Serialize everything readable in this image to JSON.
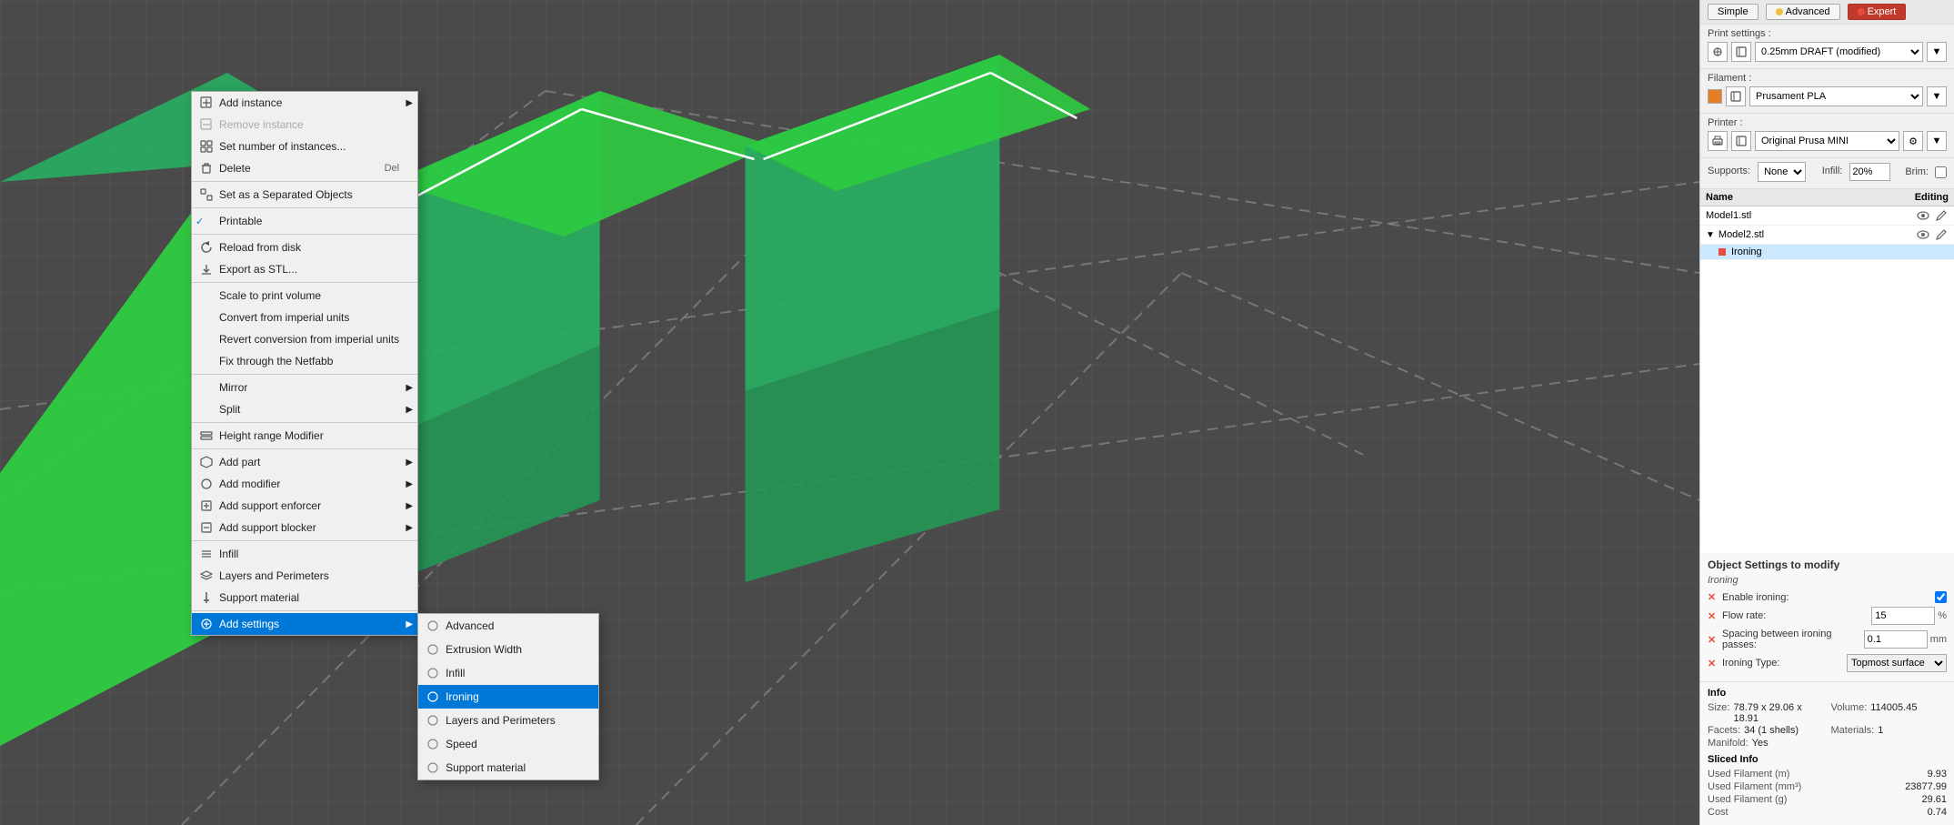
{
  "print_settings": {
    "label": "Print settings :",
    "profile": "0.25mm DRAFT (modified)",
    "filament_label": "Filament :",
    "filament": "Prusament PLA",
    "printer_label": "Printer :",
    "printer": "Original Prusa MINI",
    "supports_label": "Supports:",
    "supports_value": "None",
    "infill_label": "Infill:",
    "infill_value": "20%",
    "brim_label": "Brim:",
    "brim_checked": false
  },
  "modes": {
    "simple": "Simple",
    "advanced": "Advanced",
    "expert": "Expert"
  },
  "object_list": {
    "header_name": "Name",
    "header_editing": "Editing",
    "objects": [
      {
        "id": "model1",
        "name": "Model1.stl",
        "selected": false
      },
      {
        "id": "model2",
        "name": "Model2.stl",
        "selected": false,
        "has_child": true,
        "child": {
          "name": "Ironing",
          "selected": true
        }
      }
    ]
  },
  "context_menu": {
    "items": [
      {
        "id": "add-instance",
        "label": "Add instance",
        "icon": "+",
        "has_submenu": true,
        "shortcut": ""
      },
      {
        "id": "remove-instance",
        "label": "Remove instance",
        "icon": "-",
        "disabled": true
      },
      {
        "id": "set-number",
        "label": "Set number of instances...",
        "icon": "grid"
      },
      {
        "id": "delete",
        "label": "Delete",
        "shortcut": "Del",
        "icon": "x"
      },
      {
        "id": "sep1",
        "type": "separator"
      },
      {
        "id": "set-separated",
        "label": "Set as a Separated Objects",
        "icon": "layers"
      },
      {
        "id": "sep2",
        "type": "separator"
      },
      {
        "id": "printable",
        "label": "Printable",
        "checked": true
      },
      {
        "id": "sep3",
        "type": "separator"
      },
      {
        "id": "reload",
        "label": "Reload from disk",
        "icon": "reload"
      },
      {
        "id": "export",
        "label": "Export as STL...",
        "icon": "export"
      },
      {
        "id": "sep4",
        "type": "separator"
      },
      {
        "id": "scale-print",
        "label": "Scale to print volume"
      },
      {
        "id": "convert-imperial",
        "label": "Convert from imperial units"
      },
      {
        "id": "revert-imperial",
        "label": "Revert conversion from imperial units"
      },
      {
        "id": "fix-netfabb",
        "label": "Fix through the Netfabb"
      },
      {
        "id": "sep5",
        "type": "separator"
      },
      {
        "id": "mirror",
        "label": "Mirror",
        "has_submenu": true
      },
      {
        "id": "split",
        "label": "Split",
        "has_submenu": true
      },
      {
        "id": "sep6",
        "type": "separator"
      },
      {
        "id": "height-modifier",
        "label": "Height range Modifier",
        "icon": "height"
      },
      {
        "id": "sep7",
        "type": "separator"
      },
      {
        "id": "add-part",
        "label": "Add part",
        "has_submenu": true
      },
      {
        "id": "add-modifier",
        "label": "Add modifier",
        "has_submenu": true
      },
      {
        "id": "add-support-enforcer",
        "label": "Add support enforcer",
        "has_submenu": true
      },
      {
        "id": "add-support-blocker",
        "label": "Add support blocker",
        "has_submenu": true
      },
      {
        "id": "sep8",
        "type": "separator"
      },
      {
        "id": "infill",
        "label": "Infill"
      },
      {
        "id": "layers-perimeters",
        "label": "Layers and Perimeters"
      },
      {
        "id": "support-material",
        "label": "Support material"
      },
      {
        "id": "sep9",
        "type": "separator"
      },
      {
        "id": "add-settings",
        "label": "Add settings",
        "has_submenu": true,
        "active": true
      }
    ],
    "submenu_items": [
      {
        "id": "advanced",
        "label": "Advanced",
        "icon": "circle"
      },
      {
        "id": "extrusion-width",
        "label": "Extrusion Width",
        "icon": "circle"
      },
      {
        "id": "infill-sub",
        "label": "Infill",
        "icon": "circle"
      },
      {
        "id": "ironing",
        "label": "Ironing",
        "icon": "circle",
        "highlighted": true
      },
      {
        "id": "layers-perimeters-sub",
        "label": "Layers and Perimeters",
        "icon": "circle"
      },
      {
        "id": "speed",
        "label": "Speed",
        "icon": "circle"
      },
      {
        "id": "support-material-sub",
        "label": "Support material",
        "icon": "circle"
      }
    ]
  },
  "object_settings": {
    "title": "Object Settings to modify",
    "subtitle": "Ironing",
    "fields": [
      {
        "id": "enable-ironing",
        "label": "Enable ironing:",
        "type": "checkbox",
        "value": true
      },
      {
        "id": "flow-rate",
        "label": "Flow rate:",
        "type": "text",
        "value": "15",
        "unit": "%"
      },
      {
        "id": "spacing",
        "label": "Spacing between ironing passes:",
        "type": "text",
        "value": "0.1",
        "unit": "mm"
      },
      {
        "id": "ironing-type",
        "label": "Ironing Type:",
        "type": "select",
        "value": "Topmost surface o"
      }
    ]
  },
  "info": {
    "title": "Info",
    "size_label": "Size:",
    "size_value": "78.79 x 29.06 x 18.91",
    "volume_label": "Volume:",
    "volume_value": "114005.45",
    "facets_label": "Facets:",
    "facets_value": "34 (1 shells)",
    "materials_label": "Materials:",
    "materials_value": "1",
    "manifold_label": "Manifold:",
    "manifold_value": "Yes",
    "sliced_title": "Sliced Info",
    "sliced_rows": [
      {
        "label": "Used Filament (m)",
        "value": "9.93"
      },
      {
        "label": "Used Filament (mm³)",
        "value": "23877.99"
      },
      {
        "label": "Used Filament (g)",
        "value": "29.61"
      },
      {
        "label": "Cost",
        "value": "0.74"
      }
    ]
  },
  "topmost_surface": "Topmost surface"
}
